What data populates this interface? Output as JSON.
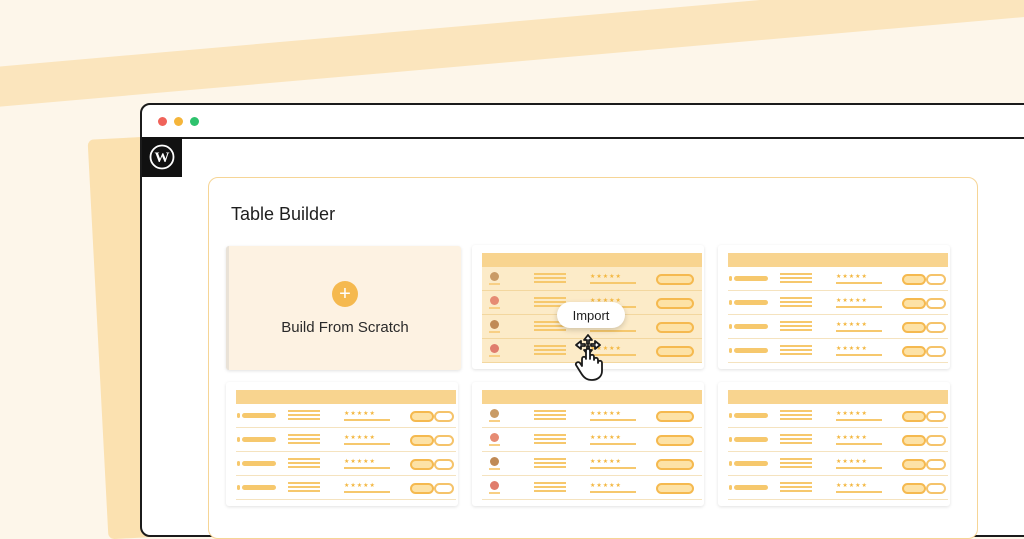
{
  "window": {
    "dots": [
      "#f0635a",
      "#f5b53a",
      "#2ec26d"
    ]
  },
  "sidebar": {
    "logo_icon": "wordpress-icon"
  },
  "panel": {
    "title": "Table Builder"
  },
  "scratch_card": {
    "icon": "plus-icon",
    "label": "Build From Scratch"
  },
  "hover_card": {
    "tooltip": "Import",
    "cursor_icon": "hand-move-cursor-icon"
  },
  "templates": [
    {
      "id": "tpl-1",
      "rows": 4,
      "avatars": true,
      "wide_button": true,
      "hovered": true
    },
    {
      "id": "tpl-2",
      "rows": 4,
      "avatars": false,
      "wide_button": false,
      "hovered": false
    },
    {
      "id": "tpl-3",
      "rows": 4,
      "avatars": false,
      "wide_button": false,
      "hovered": false
    },
    {
      "id": "tpl-4",
      "rows": 4,
      "avatars": true,
      "wide_button": true,
      "hovered": false
    },
    {
      "id": "tpl-5",
      "rows": 4,
      "avatars": false,
      "wide_button": false,
      "hovered": false
    }
  ],
  "colors": {
    "accent": "#f5b94f",
    "panel_border": "#f6d596",
    "header": "#f8d48f"
  },
  "avatar_colors": [
    "#c99b66",
    "#e68b73",
    "#c08a55",
    "#e07d6d"
  ]
}
